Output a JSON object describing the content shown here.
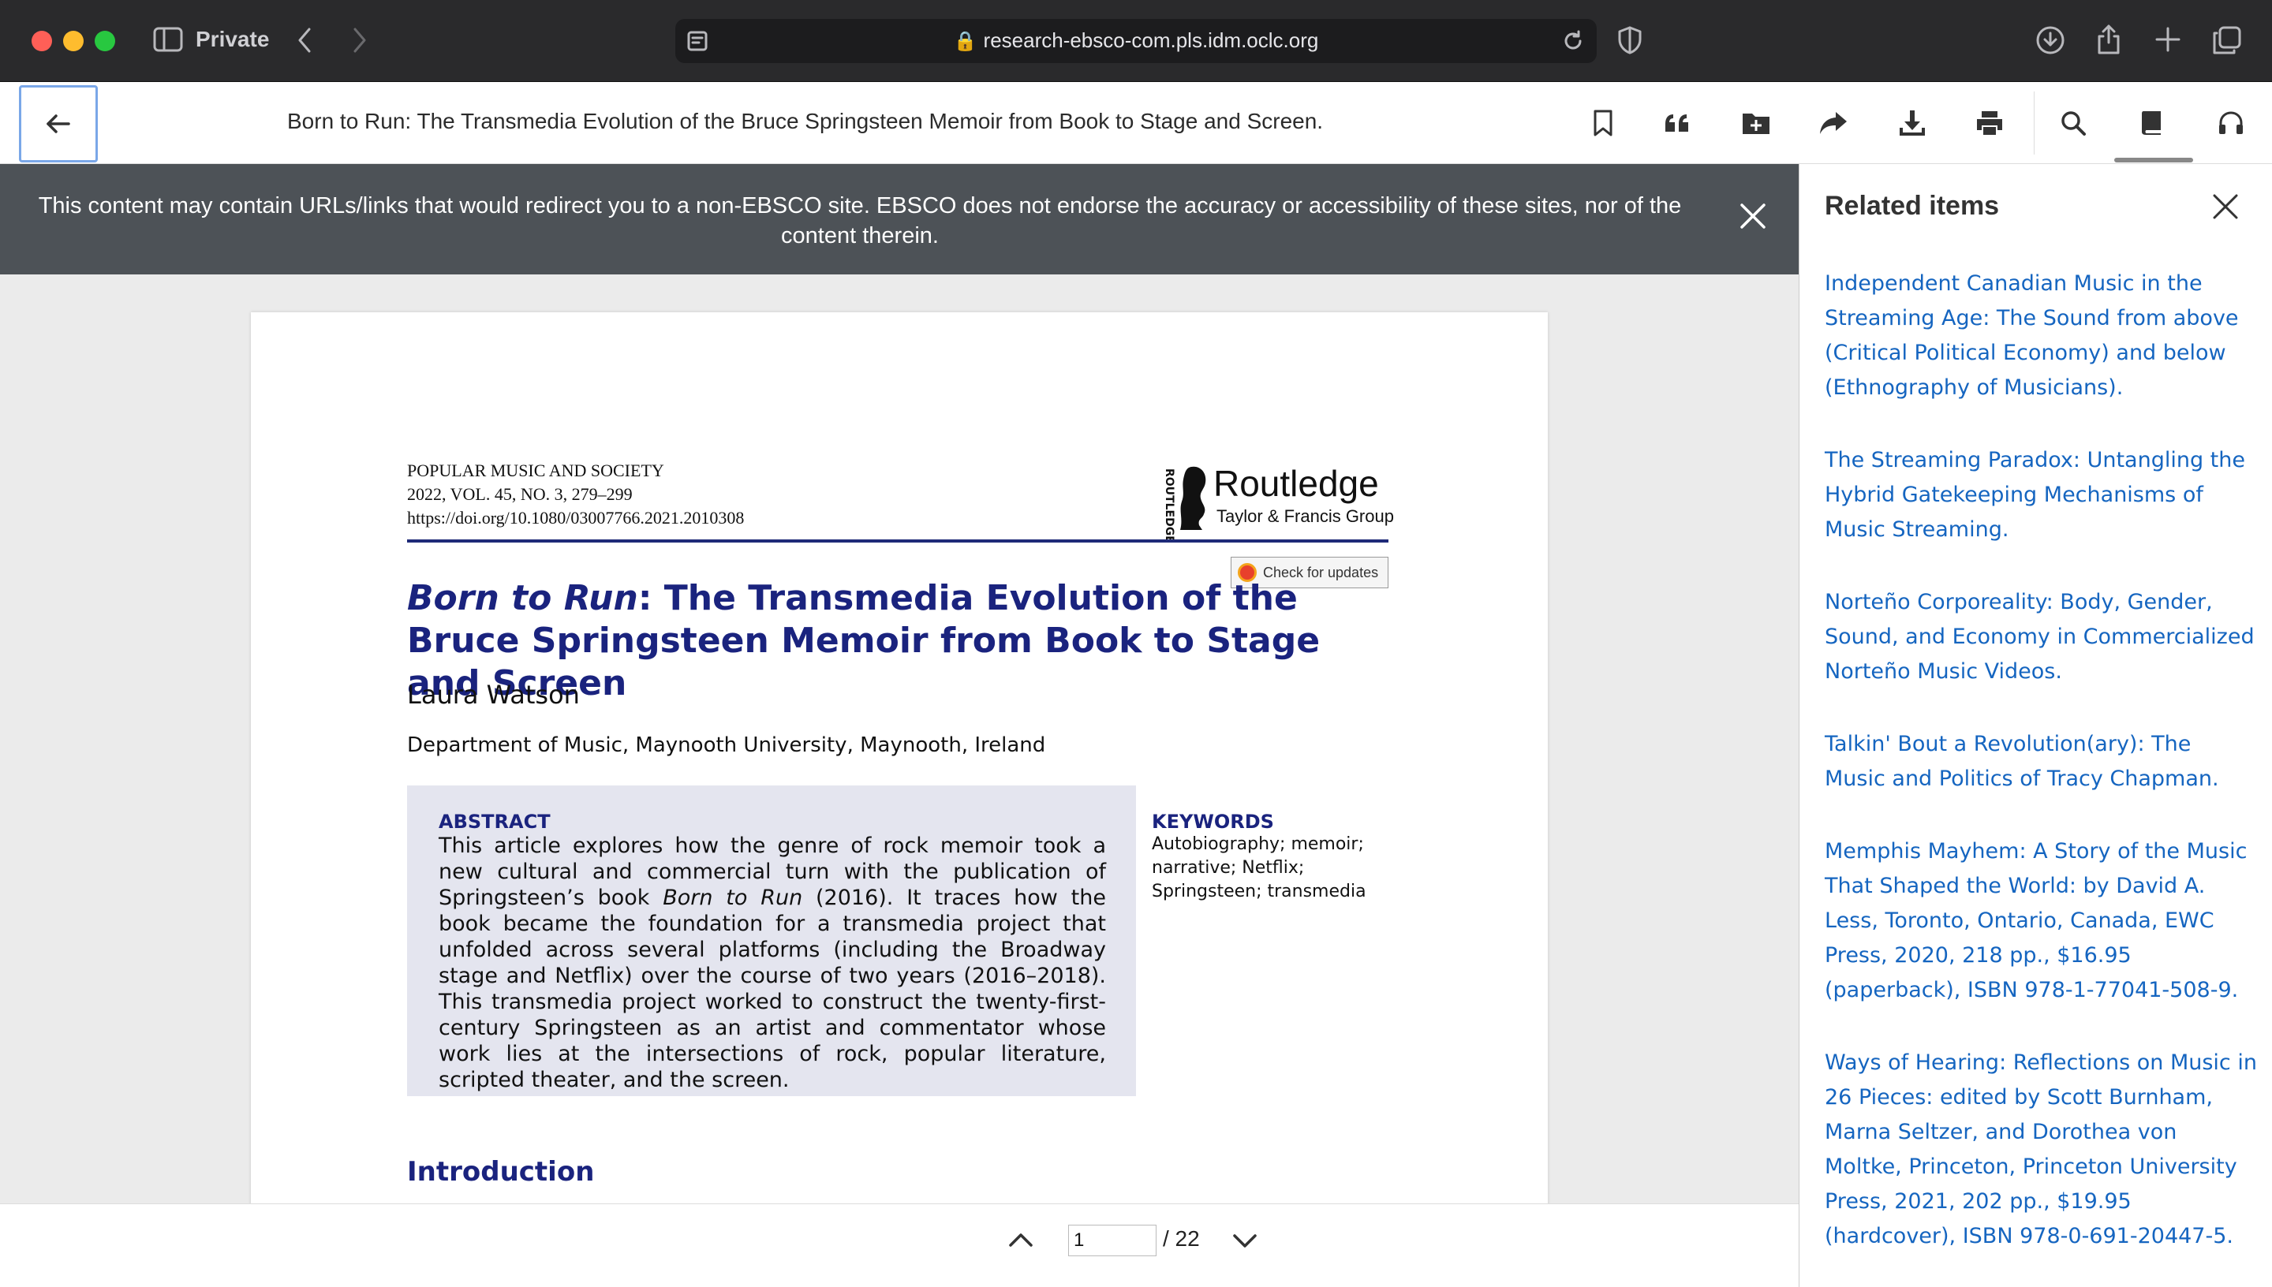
{
  "browser": {
    "private_label": "Private",
    "url": "research-ebsco-com.pls.idm.oclc.org"
  },
  "toolbar": {
    "title": "Born to Run: The Transmedia Evolution of the Bruce Springsteen Memoir from Book to Stage and Screen."
  },
  "banner": {
    "text": "This content may contain URLs/links that would redirect you to a non-EBSCO site. EBSCO does not endorse the accuracy or accessibility of these sites, nor of the content therein."
  },
  "article": {
    "journal": "POPULAR MUSIC AND SOCIETY",
    "volume": "2022, VOL. 45, NO. 3, 279–299",
    "doi": "https://doi.org/10.1080/03007766.2021.2010308",
    "publisher": "Routledge",
    "publisher_sub": "Taylor & Francis Group",
    "publisher_side": "ROUTLEDGE",
    "check_updates": "Check for updates",
    "title_italic": "Born to Run",
    "title_rest": ": The Transmedia Evolution of the Bruce Springsteen Memoir from Book to Stage and Screen",
    "author": "Laura Watson",
    "affiliation": "Department of Music, Maynooth University, Maynooth, Ireland",
    "abstract_heading": "ABSTRACT",
    "abstract_part1": "This article explores how the genre of rock memoir took a new cultural and commercial turn with the publication of Springsteen’s book ",
    "abstract_italic": "Born to Run",
    "abstract_part2": " (2016). It traces how the book became the foundation for a transmedia project that unfolded across several platforms (including the Broadway stage and Netflix) over the course of two years (2016–2018). This transmedia project worked to construct the twenty-first-century Springsteen as an artist and commentator whose work lies at the intersections of rock, popular literature, scripted theater, and the screen.",
    "keywords_heading": "KEYWORDS",
    "keywords": "Autobiography; memoir; narrative; Netflix; Springsteen; transmedia",
    "intro_heading": "Introduction"
  },
  "pager": {
    "current_page": "1",
    "total": "/ 22"
  },
  "related": {
    "heading": "Related items",
    "items": [
      "Independent Canadian Music in the Streaming Age: The Sound from above (Critical Political Economy) and below (Ethnography of Musicians).",
      "The Streaming Paradox: Untangling the Hybrid Gatekeeping Mechanisms of Music Streaming.",
      "Norteño Corporeality: Body, Gender, Sound, and Economy in Commercialized Norteño Music Videos.",
      "Talkin' Bout a Revolution(ary): The Music and Politics of Tracy Chapman.",
      "Memphis Mayhem: A Story of the Music That Shaped the World: by David A. Less, Toronto, Ontario, Canada, EWC Press, 2020, 218 pp., $16.95 (paperback), ISBN 978-1-77041-508-9.",
      "Ways of Hearing: Reflections on Music in 26 Pieces: edited by Scott Burnham, Marna Seltzer, and Dorothea von Moltke, Princeton, Princeton University Press, 2021, 202 pp., $19.95 (hardcover), ISBN 978-0-691-20447-5."
    ]
  }
}
